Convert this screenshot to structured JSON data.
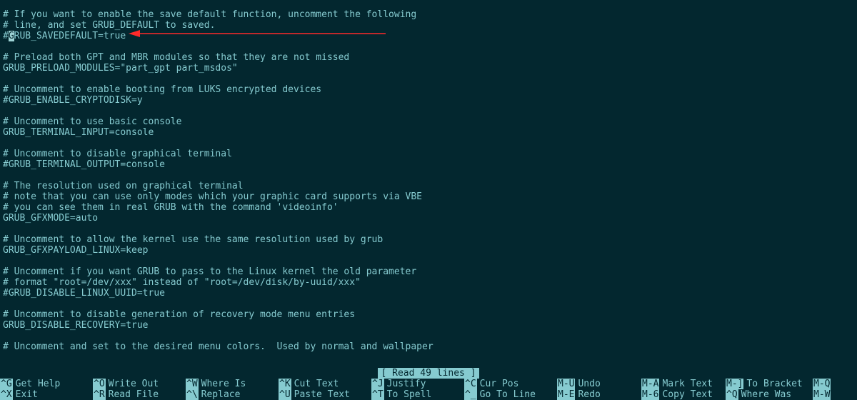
{
  "file_lines": [
    "# If you want to enable the save default function, uncomment the following",
    "# line, and set GRUB_DEFAULT to saved.",
    "#GRUB_SAVEDEFAULT=true",
    "",
    "# Preload both GPT and MBR modules so that they are not missed",
    "GRUB_PRELOAD_MODULES=\"part_gpt part_msdos\"",
    "",
    "# Uncomment to enable booting from LUKS encrypted devices",
    "#GRUB_ENABLE_CRYPTODISK=y",
    "",
    "# Uncomment to use basic console",
    "GRUB_TERMINAL_INPUT=console",
    "",
    "# Uncomment to disable graphical terminal",
    "#GRUB_TERMINAL_OUTPUT=console",
    "",
    "# The resolution used on graphical terminal",
    "# note that you can use only modes which your graphic card supports via VBE",
    "# you can see them in real GRUB with the command 'videoinfo'",
    "GRUB_GFXMODE=auto",
    "",
    "# Uncomment to allow the kernel use the same resolution used by grub",
    "GRUB_GFXPAYLOAD_LINUX=keep",
    "",
    "# Uncomment if you want GRUB to pass to the Linux kernel the old parameter",
    "# format \"root=/dev/xxx\" instead of \"root=/dev/disk/by-uuid/xxx\"",
    "#GRUB_DISABLE_LINUX_UUID=true",
    "",
    "# Uncomment to disable generation of recovery mode menu entries",
    "GRUB_DISABLE_RECOVERY=true",
    "",
    "# Uncomment and set to the desired menu colors.  Used by normal and wallpaper"
  ],
  "cursor": {
    "line": 2,
    "col": 1
  },
  "status": "[ Read 49 lines ]",
  "help": {
    "cols": [
      130,
      130,
      130,
      130,
      130,
      130,
      118,
      118,
      122,
      62
    ],
    "row1": [
      {
        "k": "^G",
        "l": "Get Help"
      },
      {
        "k": "^O",
        "l": "Write Out"
      },
      {
        "k": "^W",
        "l": "Where Is"
      },
      {
        "k": "^K",
        "l": "Cut Text"
      },
      {
        "k": "^J",
        "l": "Justify"
      },
      {
        "k": "^C",
        "l": "Cur Pos"
      },
      {
        "k": "M-U",
        "l": "Undo"
      },
      {
        "k": "M-A",
        "l": "Mark Text"
      },
      {
        "k": "M-]",
        "l": "To Bracket"
      },
      {
        "k": "M-Q",
        "l": ""
      }
    ],
    "row2": [
      {
        "k": "^X",
        "l": "Exit"
      },
      {
        "k": "^R",
        "l": "Read File"
      },
      {
        "k": "^\\",
        "l": "Replace"
      },
      {
        "k": "^U",
        "l": "Paste Text"
      },
      {
        "k": "^T",
        "l": "To Spell"
      },
      {
        "k": "^_",
        "l": "Go To Line"
      },
      {
        "k": "M-E",
        "l": "Redo"
      },
      {
        "k": "M-6",
        "l": "Copy Text"
      },
      {
        "k": "^Q",
        "l": "Where Was"
      },
      {
        "k": "M-W",
        "l": ""
      }
    ]
  }
}
